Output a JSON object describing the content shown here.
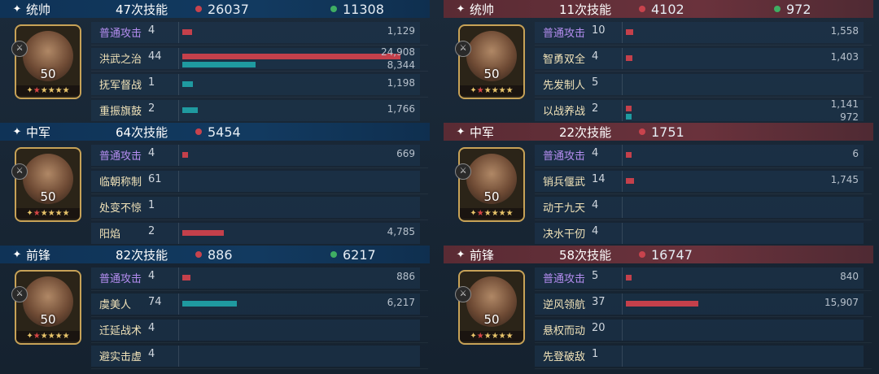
{
  "left": {
    "sections": [
      {
        "role": "统帅",
        "casts": "47次技能",
        "damage": "26037",
        "heal": "11308",
        "level": "50",
        "skills": [
          {
            "name": "普通攻击",
            "count": "4",
            "damage": "1,129",
            "heal": null
          },
          {
            "name": "洪武之治",
            "count": "44",
            "damage": "24,908",
            "heal": "8,344"
          },
          {
            "name": "抚军督战",
            "count": "1",
            "damage": null,
            "heal": "1,198"
          },
          {
            "name": "重振旗鼓",
            "count": "2",
            "damage": null,
            "heal": "1,766"
          }
        ]
      },
      {
        "role": "中军",
        "casts": "64次技能",
        "damage": "5454",
        "heal": null,
        "level": "50",
        "skills": [
          {
            "name": "普通攻击",
            "count": "4",
            "damage": "669",
            "heal": null
          },
          {
            "name": "临朝称制",
            "count": "61",
            "damage": null,
            "heal": null
          },
          {
            "name": "处变不惊",
            "count": "1",
            "damage": null,
            "heal": null
          },
          {
            "name": "阳焰",
            "count": "2",
            "damage": "4,785",
            "heal": null
          }
        ]
      },
      {
        "role": "前锋",
        "casts": "82次技能",
        "damage": "886",
        "heal": "6217",
        "level": "50",
        "skills": [
          {
            "name": "普通攻击",
            "count": "4",
            "damage": "886",
            "heal": null
          },
          {
            "name": "虞美人",
            "count": "74",
            "damage": null,
            "heal": "6,217"
          },
          {
            "name": "迁延战术",
            "count": "4",
            "damage": null,
            "heal": null
          },
          {
            "name": "避实击虚",
            "count": "4",
            "damage": null,
            "heal": null
          }
        ]
      }
    ]
  },
  "right": {
    "sections": [
      {
        "role": "统帅",
        "casts": "11次技能",
        "damage": "4102",
        "heal": "972",
        "level": "50",
        "skills": [
          {
            "name": "普通攻击",
            "count": "10",
            "damage": "1,558",
            "heal": null
          },
          {
            "name": "智勇双全",
            "count": "4",
            "damage": "1,403",
            "heal": null
          },
          {
            "name": "先发制人",
            "count": "5",
            "damage": null,
            "heal": null
          },
          {
            "name": "以战养战",
            "count": "2",
            "damage": "1,141",
            "heal": "972"
          }
        ]
      },
      {
        "role": "中军",
        "casts": "22次技能",
        "damage": "1751",
        "heal": null,
        "level": "50",
        "skills": [
          {
            "name": "普通攻击",
            "count": "4",
            "damage": "6",
            "heal": null
          },
          {
            "name": "销兵偃武",
            "count": "14",
            "damage": "1,745",
            "heal": null
          },
          {
            "name": "动于九天",
            "count": "4",
            "damage": null,
            "heal": null
          },
          {
            "name": "决水干仞",
            "count": "4",
            "damage": null,
            "heal": null
          }
        ]
      },
      {
        "role": "前锋",
        "casts": "58次技能",
        "damage": "16747",
        "heal": null,
        "level": "50",
        "skills": [
          {
            "name": "普通攻击",
            "count": "5",
            "damage": "840",
            "heal": null
          },
          {
            "name": "逆风领航",
            "count": "37",
            "damage": "15,907",
            "heal": null
          },
          {
            "name": "悬权而动",
            "count": "20",
            "damage": null,
            "heal": null
          },
          {
            "name": "先登破敌",
            "count": "1",
            "damage": null,
            "heal": null
          }
        ]
      }
    ]
  },
  "bar_scale_max": 24908,
  "colors": {
    "damage": "#c4404b",
    "heal": "#1f9aa0",
    "basic_attack": "#b48df0",
    "skill_name": "#f0e2b8"
  }
}
